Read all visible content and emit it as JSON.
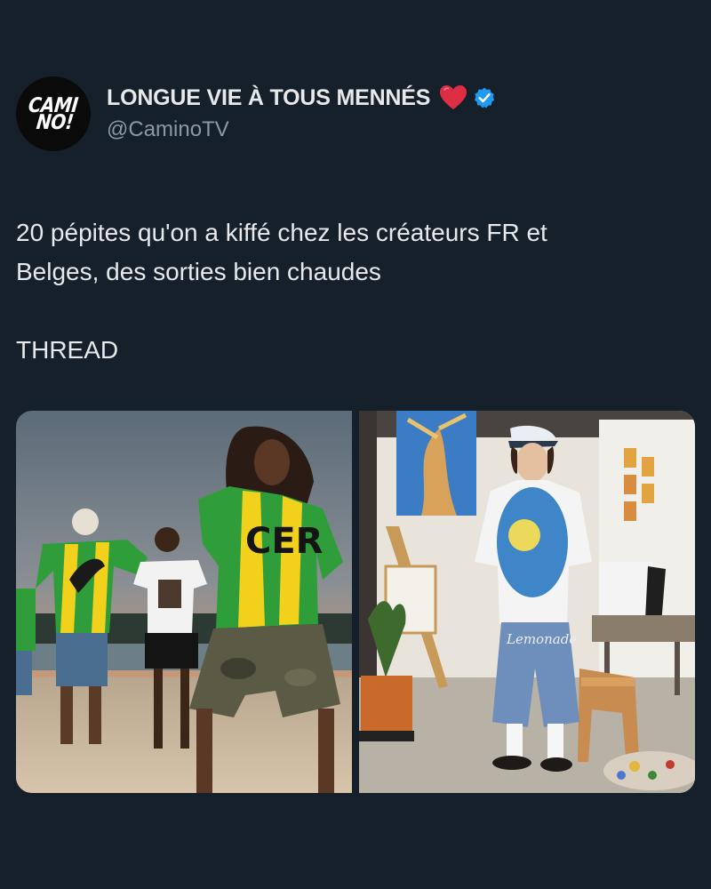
{
  "profile": {
    "avatar_line1": "CAMI",
    "avatar_line2": "NO!",
    "display_name": "LONGUE VIE À TOUS MENNÉS",
    "handle": "@CaminoTV",
    "heart_icon": "red-heart-emoji",
    "verified_icon": "verified-badge",
    "verified_color": "#1d9bf0"
  },
  "tweet": {
    "line1": "20 pépites qu'on a kiffé chez les créateurs FR et",
    "line2": "Belges, des sorties bien chaudes",
    "line3": "THREAD"
  },
  "media": {
    "left_photo": {
      "shirt_text": "CER"
    },
    "right_photo": {
      "shorts_text": "Lemonade"
    }
  },
  "colors": {
    "background": "#15202b",
    "text": "#e7e9ea",
    "secondary_text": "#8b98a5"
  }
}
